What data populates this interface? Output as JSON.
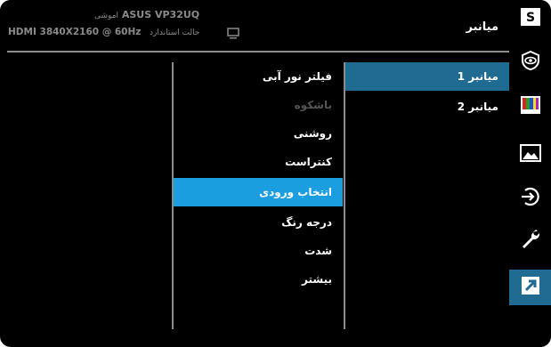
{
  "header": {
    "title": "میانبر",
    "line1_small": "اموشی",
    "line1_model": "ASUS  VP32UQ",
    "line2_small": "حالت استاندارد",
    "line2_signal": "HDMI 3840X2160 @ 60Hz"
  },
  "sidebar": {
    "items": [
      {
        "icon": "splendid-s-icon",
        "letter": "S"
      },
      {
        "icon": "eye-care-icon"
      },
      {
        "icon": "color-bars-icon"
      },
      {
        "icon": "image-icon"
      },
      {
        "icon": "input-select-icon"
      },
      {
        "icon": "wrench-icon"
      },
      {
        "icon": "shortcut-arrow-icon",
        "active": true
      }
    ],
    "active_color": "#1f6b92"
  },
  "menu": {
    "items": [
      {
        "label": "فیلتر نور آبی"
      },
      {
        "label": "باشکوه",
        "disabled": true
      },
      {
        "label": "روشنی"
      },
      {
        "label": "کنتراست"
      },
      {
        "label": "انتخاب ورودی",
        "active": true
      },
      {
        "label": "درجه رنگ"
      },
      {
        "label": "شدت"
      },
      {
        "label": "بیشتر"
      }
    ],
    "active_color": "#1a9ee0"
  },
  "submenu": {
    "items": [
      {
        "label": "میانبر 1",
        "active": true
      },
      {
        "label": "میانبر 2"
      }
    ]
  }
}
